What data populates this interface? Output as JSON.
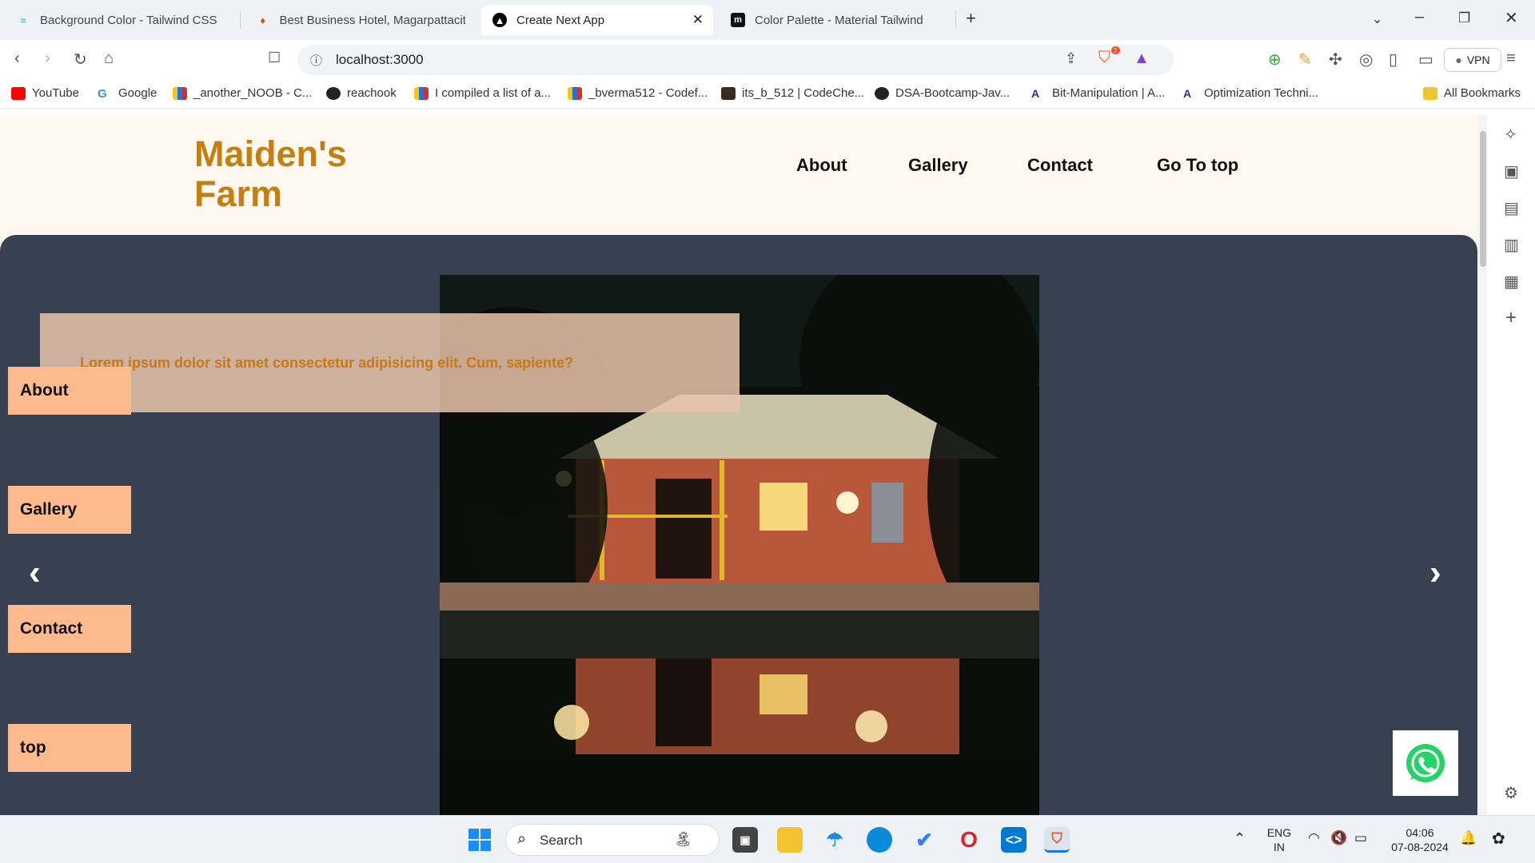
{
  "browser": {
    "tabs": [
      {
        "label": "Background Color - Tailwind CSS",
        "icon": "tailwind-icon",
        "active": false
      },
      {
        "label": "Best Business Hotel, Magarpattacity",
        "icon": "hotel-icon",
        "active": false
      },
      {
        "label": "Create Next App",
        "icon": "nextjs-icon",
        "active": true
      },
      {
        "label": "Color Palette - Material Tailwind",
        "icon": "material-tailwind-icon",
        "active": false
      }
    ],
    "url": "localhost:3000",
    "vpn_label": "VPN",
    "shield_badge": "1",
    "bookmarks": [
      {
        "label": "YouTube",
        "icon": "youtube-icon"
      },
      {
        "label": "Google",
        "icon": "google-icon"
      },
      {
        "label": "_another_NOOB - C...",
        "icon": "codeforces-icon"
      },
      {
        "label": "reachook",
        "icon": "github-icon"
      },
      {
        "label": "I compiled a list of a...",
        "icon": "codeforces-icon"
      },
      {
        "label": "_bverma512 - Codef...",
        "icon": "codeforces-icon"
      },
      {
        "label": "its_b_512 | CodeChe...",
        "icon": "codechef-icon"
      },
      {
        "label": "DSA-Bootcamp-Jav...",
        "icon": "github-icon"
      },
      {
        "label": "Bit-Manipulation | A...",
        "icon": "algomaster-icon"
      },
      {
        "label": "Optimization Techni...",
        "icon": "algomaster-icon"
      }
    ],
    "all_bookmarks": "All Bookmarks"
  },
  "page": {
    "logo_line1": "Maiden's",
    "logo_line2": "Farm",
    "nav": [
      "About",
      "Gallery",
      "Contact",
      "Go To top"
    ],
    "caption": "Lorem ipsum dolor sit amet consectetur adipisicing elit. Cum, sapiente?",
    "side_buttons": [
      "About",
      "Gallery",
      "Contact",
      "top"
    ],
    "colors": {
      "logo": "#c47f10",
      "hero_bg": "#374151",
      "side_button_bg": "#fdba8c",
      "caption_text": "#c87a14",
      "page_bg": "#fff8f1"
    }
  },
  "taskbar": {
    "search_placeholder": "Search",
    "lang_line1": "ENG",
    "lang_line2": "IN",
    "time": "04:06",
    "date": "07-08-2024"
  }
}
